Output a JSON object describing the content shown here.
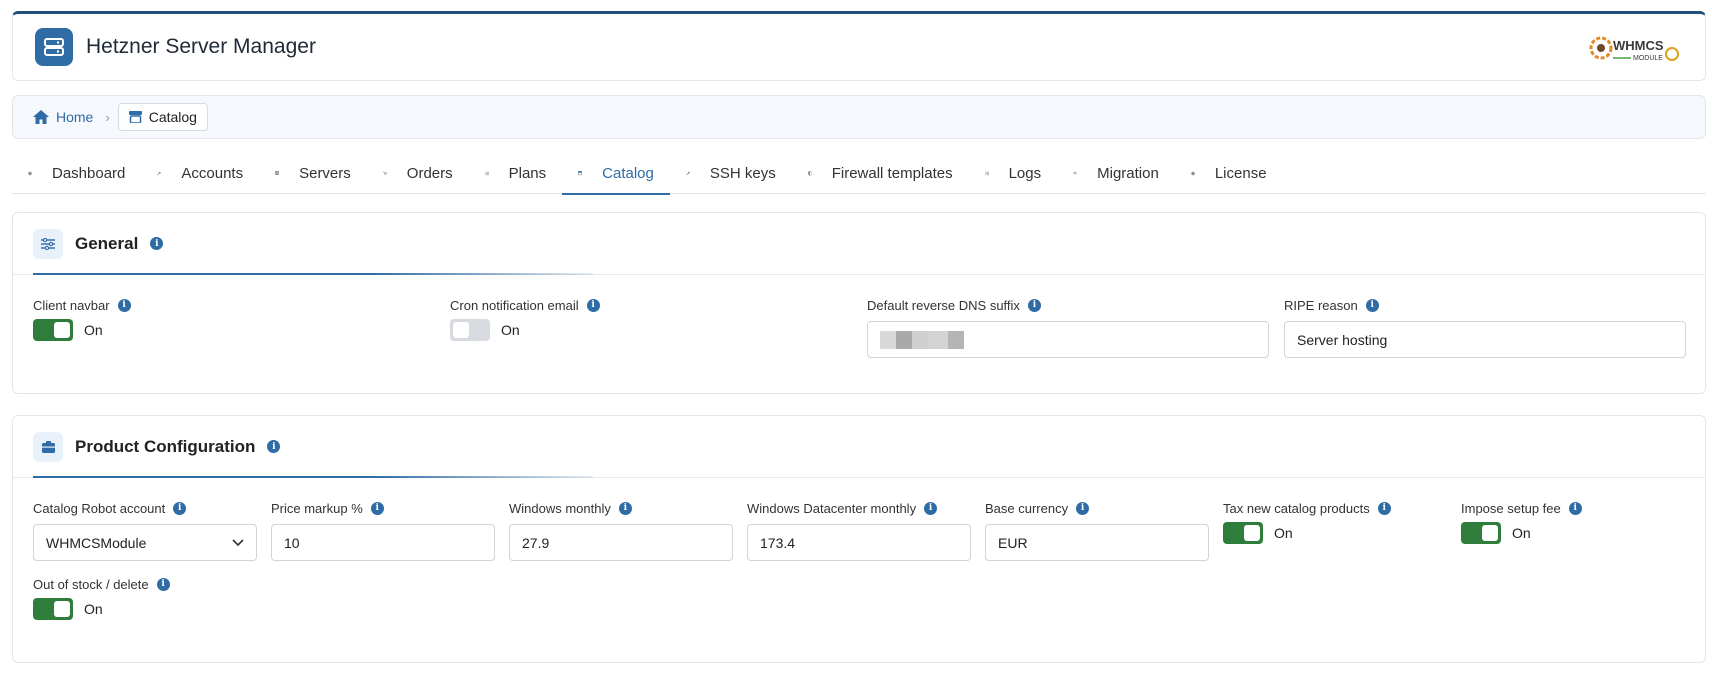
{
  "header": {
    "title": "Hetzner Server Manager",
    "logo_text": "WHMCS MODULE"
  },
  "breadcrumb": {
    "home": "Home",
    "current": "Catalog"
  },
  "tabs": [
    {
      "label": "Dashboard",
      "icon": "gauge-icon"
    },
    {
      "label": "Accounts",
      "icon": "key-icon"
    },
    {
      "label": "Servers",
      "icon": "server-icon"
    },
    {
      "label": "Orders",
      "icon": "cart-icon"
    },
    {
      "label": "Plans",
      "icon": "list-icon"
    },
    {
      "label": "Catalog",
      "icon": "store-icon",
      "active": true
    },
    {
      "label": "SSH keys",
      "icon": "key-icon"
    },
    {
      "label": "Firewall templates",
      "icon": "shield-icon"
    },
    {
      "label": "Logs",
      "icon": "list-icon"
    },
    {
      "label": "Migration",
      "icon": "arrows-icon"
    },
    {
      "label": "License",
      "icon": "badge-icon"
    }
  ],
  "general": {
    "title": "General",
    "client_navbar": {
      "label": "Client navbar",
      "state": "On",
      "on": true
    },
    "cron_email": {
      "label": "Cron notification email",
      "state": "On",
      "on": false
    },
    "rdns_suffix": {
      "label": "Default reverse DNS suffix",
      "value": ""
    },
    "ripe_reason": {
      "label": "RIPE reason",
      "value": "Server hosting"
    }
  },
  "product_config": {
    "title": "Product Configuration",
    "robot_account": {
      "label": "Catalog Robot account",
      "value": "WHMCSModule"
    },
    "price_markup": {
      "label": "Price markup %",
      "value": "10"
    },
    "windows_monthly": {
      "label": "Windows monthly",
      "value": "27.9"
    },
    "windows_dc_monthly": {
      "label": "Windows Datacenter monthly",
      "value": "173.4"
    },
    "base_currency": {
      "label": "Base currency",
      "value": "EUR"
    },
    "tax_new": {
      "label": "Tax new catalog products",
      "state": "On",
      "on": true
    },
    "setup_fee": {
      "label": "Impose setup fee",
      "state": "On",
      "on": true
    },
    "out_of_stock": {
      "label": "Out of stock / delete",
      "state": "On",
      "on": true
    }
  },
  "colors": {
    "primary": "#2f6ba4",
    "toggle_on": "#2e7d3a",
    "toggle_off": "#d7dbe0"
  }
}
